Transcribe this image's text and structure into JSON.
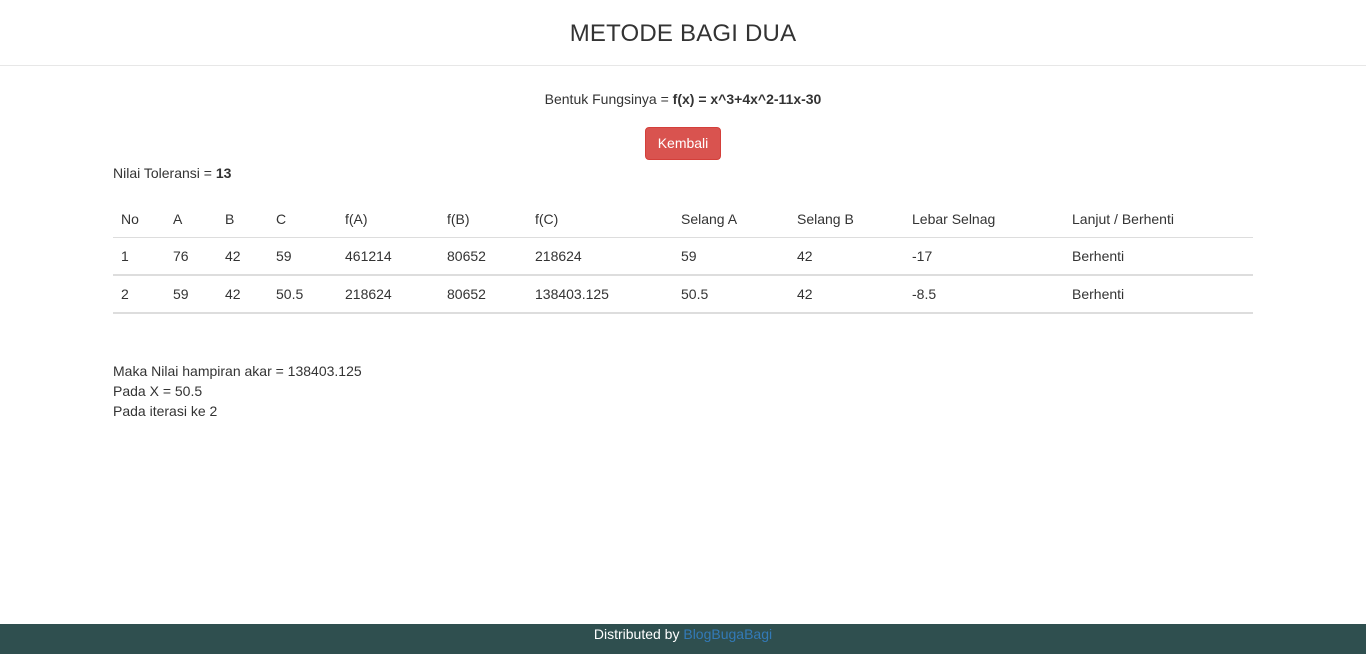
{
  "header": {
    "title": "METODE BAGI DUA"
  },
  "function": {
    "label": "Bentuk Fungsinya = ",
    "expression": "f(x) = x^3+4x^2-11x-30"
  },
  "back_button": {
    "label": "Kembali",
    "color": "#d9534f"
  },
  "tolerance": {
    "label": "Nilai Toleransi = ",
    "value": "13"
  },
  "table": {
    "headers": [
      "No",
      "A",
      "B",
      "C",
      "f(A)",
      "f(B)",
      "f(C)",
      "Selang A",
      "Selang B",
      "Lebar Selnag",
      "Lanjut / Berhenti"
    ],
    "rows": [
      [
        "1",
        "76",
        "42",
        "59",
        "461214",
        "80652",
        "218624",
        "59",
        "42",
        "-17",
        "Berhenti"
      ],
      [
        "2",
        "59",
        "42",
        "50.5",
        "218624",
        "80652",
        "138403.125",
        "50.5",
        "42",
        "-8.5",
        "Berhenti"
      ]
    ]
  },
  "summary": {
    "line1": "Maka Nilai hampiran akar = 138403.125",
    "line2": "Pada X = 50.5",
    "line3": "Pada iterasi ke 2"
  },
  "footer": {
    "text": "Distributed by ",
    "link_label": "BlogBugaBagi",
    "background": "#2f4f4f",
    "link_color": "#337ab7"
  }
}
